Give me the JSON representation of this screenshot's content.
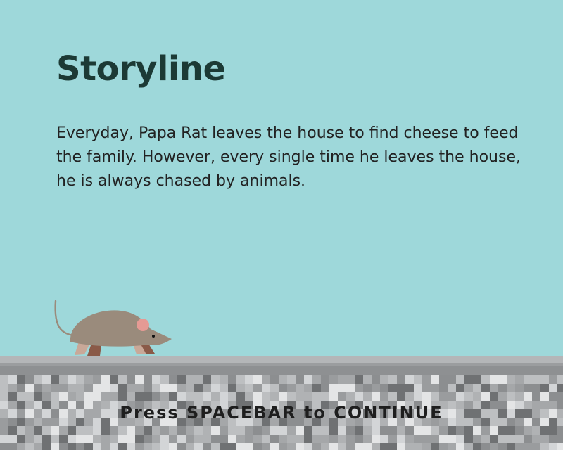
{
  "screen": {
    "title": "Storyline",
    "story": "Everyday, Papa Rat leaves the house to find cheese to feed the family. However, every single time he leaves the house, he is always chased by animals.",
    "prompt": "Press SPACEBAR to CONTINUE"
  },
  "sprites": {
    "player": "rat-sprite",
    "ground": "pixel-stone-ground"
  },
  "colors": {
    "sky": "#9ed8da",
    "title": "#1c3a35",
    "text": "#222222",
    "rat_body": "#9a8b7c",
    "rat_ear": "#e59a94",
    "ground_top": "#b4b6b8"
  }
}
